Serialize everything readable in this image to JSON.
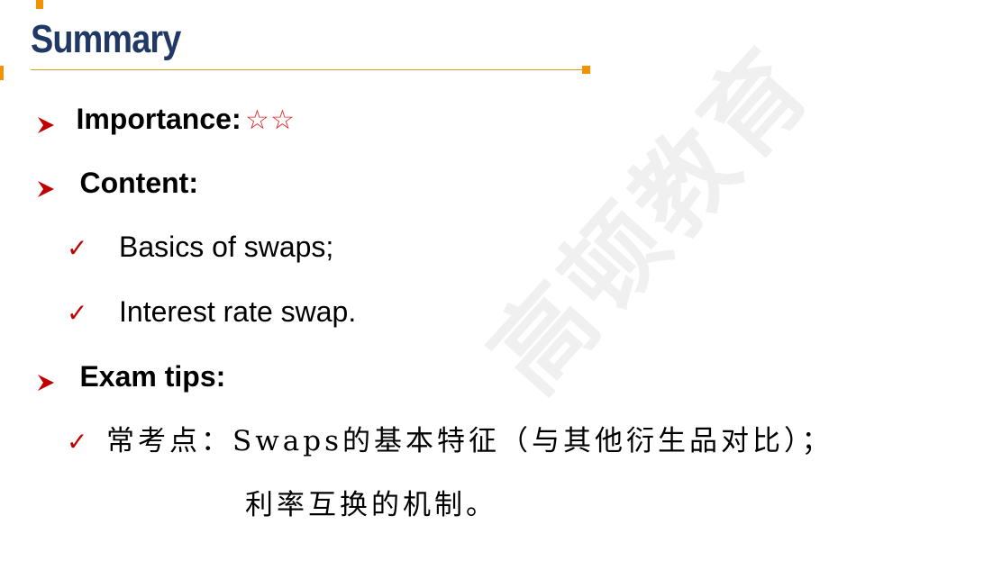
{
  "slide": {
    "title": "Summary",
    "accent_color": "#f39200",
    "title_color": "#1f3864"
  },
  "importance": {
    "label": "Importance:",
    "stars": "☆☆"
  },
  "content": {
    "label": "Content:",
    "items": [
      "Basics of swaps;",
      "Interest rate swap."
    ]
  },
  "exam_tips": {
    "label": "Exam tips:",
    "line1": "常考点：Swaps的基本特征（与其他衍生品对比）；",
    "line2": "利率互换的机制。"
  },
  "watermark": "高顿教育",
  "icons": {
    "bullet": "arrow-bullet-icon",
    "check": "checkmark-icon"
  }
}
